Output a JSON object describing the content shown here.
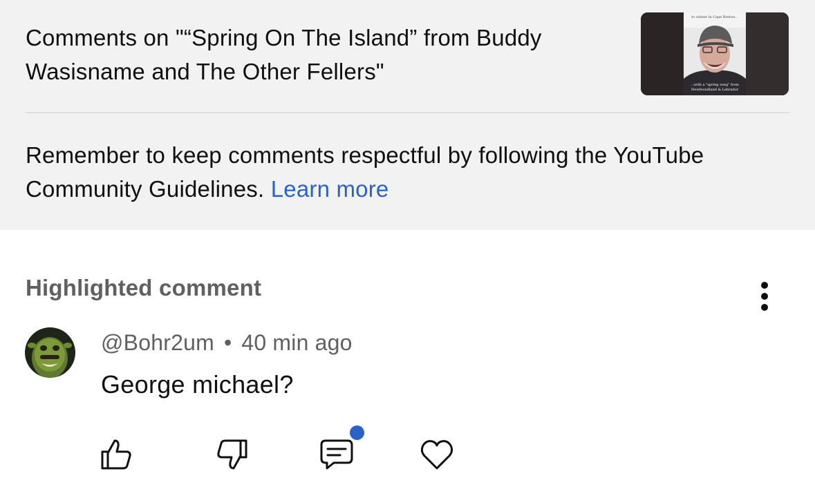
{
  "header": {
    "title": "Comments on \"“Spring On The Island” from Buddy Wasisname and The Other Fellers\"",
    "thumbnail": {
      "top_caption": "to winter in Cape Breton...",
      "bottom_caption_line1": "...with a \"spring song\" from",
      "bottom_caption_line2": "Newfoundland & Labrador"
    }
  },
  "guidelines": {
    "text": "Remember to keep comments respectful by following the YouTube Community Guidelines.",
    "link_label": "Learn more"
  },
  "highlighted": {
    "section_label": "Highlighted comment",
    "author": "@Bohr2um",
    "separator": "•",
    "time": "40 min ago",
    "text": "George michael?"
  },
  "actions": [
    "like-icon",
    "dislike-icon",
    "reply-icon",
    "heart-icon"
  ],
  "colors": {
    "accent": "#2a62c9",
    "panel": "#f2f2f2",
    "secondary_text": "#606060"
  }
}
